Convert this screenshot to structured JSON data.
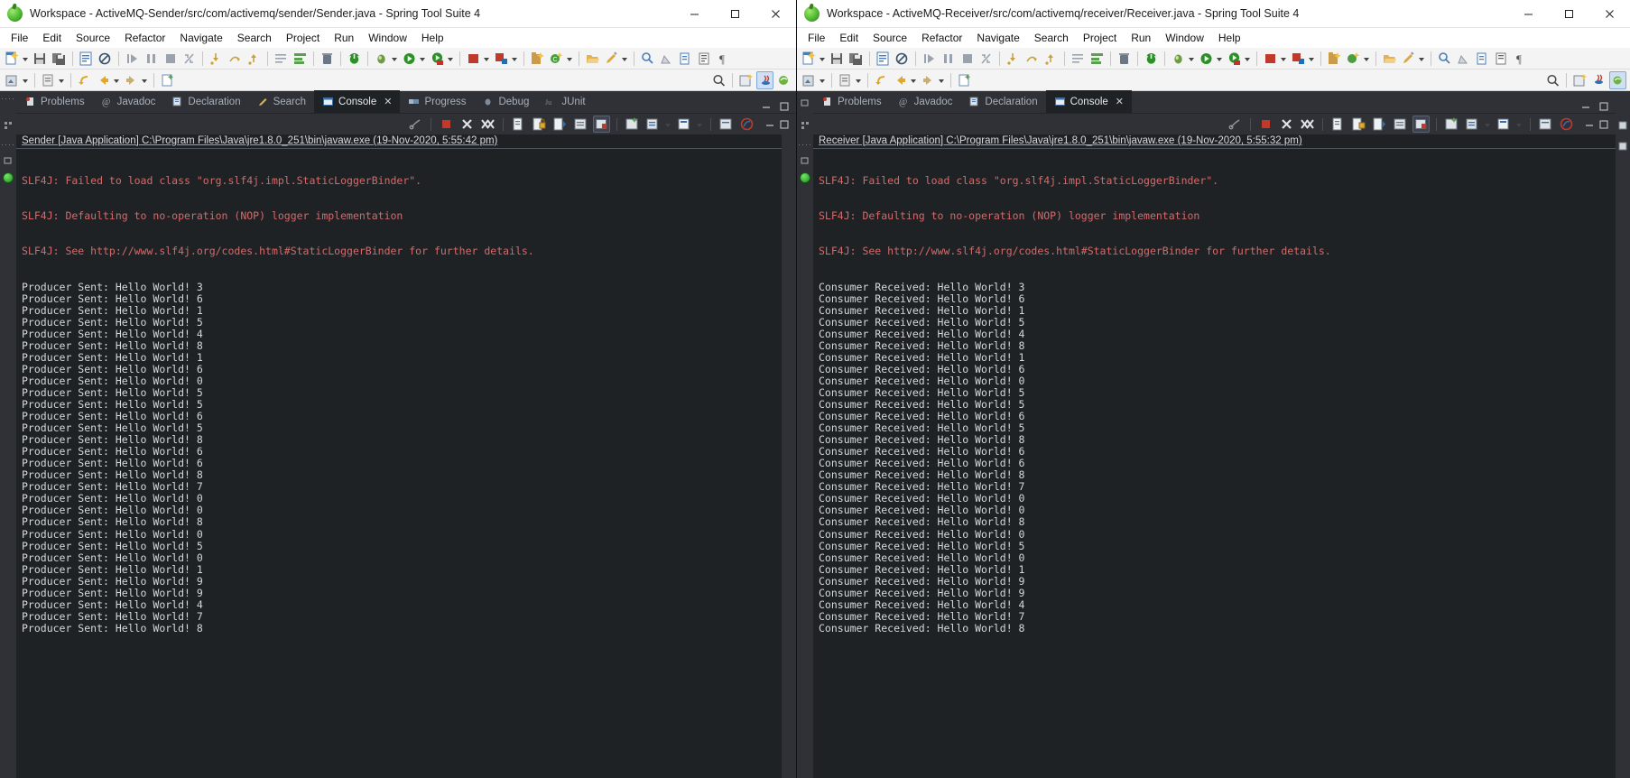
{
  "windows": [
    {
      "id": "sender",
      "title": "Workspace - ActiveMQ-Sender/src/com/activemq/sender/Sender.java - Spring Tool Suite 4",
      "controls": {
        "minimize": "–",
        "maximize": "□",
        "close": "✕"
      },
      "menu": [
        "File",
        "Edit",
        "Source",
        "Refactor",
        "Navigate",
        "Search",
        "Project",
        "Run",
        "Window",
        "Help"
      ],
      "tabs": [
        {
          "label": "Problems",
          "icon": "problems-icon",
          "active": false
        },
        {
          "label": "Javadoc",
          "icon": "javadoc-icon",
          "active": false
        },
        {
          "label": "Declaration",
          "icon": "declaration-icon",
          "active": false
        },
        {
          "label": "Search",
          "icon": "search-icon",
          "active": false
        },
        {
          "label": "Console",
          "icon": "console-icon",
          "active": true,
          "close": "✕"
        },
        {
          "label": "Progress",
          "icon": "progress-icon",
          "active": false
        },
        {
          "label": "Debug",
          "icon": "debug-icon",
          "active": false
        },
        {
          "label": "JUnit",
          "icon": "junit-icon",
          "active": false
        }
      ],
      "console": {
        "header": "Sender [Java Application] C:\\Program Files\\Java\\jre1.8.0_251\\bin\\javaw.exe  (19-Nov-2020, 5:55:42 pm)",
        "error_lines": [
          "SLF4J: Failed to load class \"org.slf4j.impl.StaticLoggerBinder\".",
          "SLF4J: Defaulting to no-operation (NOP) logger implementation",
          "SLF4J: See http://www.slf4j.org/codes.html#StaticLoggerBinder for further details."
        ],
        "output_prefix": "Producer Sent: Hello World! ",
        "output_values": [
          3,
          6,
          1,
          5,
          4,
          8,
          1,
          6,
          0,
          5,
          5,
          6,
          5,
          8,
          6,
          6,
          8,
          7,
          0,
          0,
          8,
          0,
          5,
          0,
          1,
          9,
          9,
          4,
          7,
          8
        ]
      }
    },
    {
      "id": "receiver",
      "title": "Workspace - ActiveMQ-Receiver/src/com/activemq/receiver/Receiver.java - Spring Tool Suite 4",
      "controls": {
        "minimize": "–",
        "maximize": "□",
        "close": "✕"
      },
      "menu": [
        "File",
        "Edit",
        "Source",
        "Refactor",
        "Navigate",
        "Search",
        "Project",
        "Run",
        "Window",
        "Help"
      ],
      "tabs": [
        {
          "label": "Problems",
          "icon": "problems-icon",
          "active": false
        },
        {
          "label": "Javadoc",
          "icon": "javadoc-icon",
          "active": false
        },
        {
          "label": "Declaration",
          "icon": "declaration-icon",
          "active": false
        },
        {
          "label": "Console",
          "icon": "console-icon",
          "active": true,
          "close": "✕"
        }
      ],
      "console": {
        "header": "Receiver [Java Application] C:\\Program Files\\Java\\jre1.8.0_251\\bin\\javaw.exe  (19-Nov-2020, 5:55:32 pm)",
        "error_lines": [
          "SLF4J: Failed to load class \"org.slf4j.impl.StaticLoggerBinder\".",
          "SLF4J: Defaulting to no-operation (NOP) logger implementation",
          "SLF4J: See http://www.slf4j.org/codes.html#StaticLoggerBinder for further details."
        ],
        "output_prefix": "Consumer Received: Hello World! ",
        "output_values": [
          3,
          6,
          1,
          5,
          4,
          8,
          1,
          6,
          0,
          5,
          5,
          6,
          5,
          8,
          6,
          6,
          8,
          7,
          0,
          0,
          8,
          0,
          5,
          0,
          1,
          9,
          9,
          4,
          7,
          8
        ]
      }
    }
  ],
  "colors": {
    "console_bg": "#1f2225",
    "chrome_bg": "#2f3136",
    "error_text": "#d46a6a",
    "output_text": "#d6d9dc",
    "titlebar_bg": "#ffffff",
    "toolbar_bg": "#f4f4f4",
    "accent_green": "#34a12b"
  }
}
